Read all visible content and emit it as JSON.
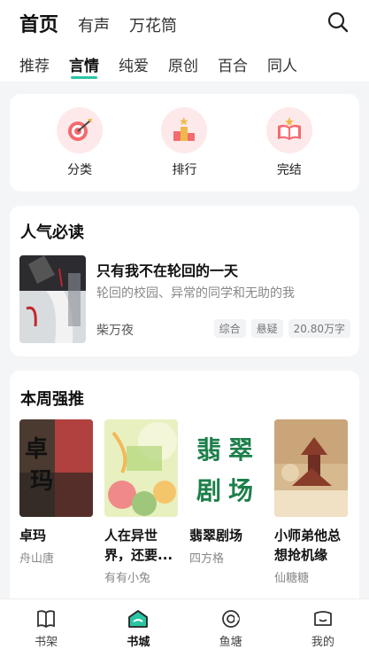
{
  "header": {
    "top_tabs": [
      "首页",
      "有声",
      "万花筒"
    ],
    "sub_tabs": [
      "推荐",
      "言情",
      "纯爱",
      "原创",
      "百合",
      "同人"
    ]
  },
  "categories": [
    {
      "label": "分类",
      "icon": "target-icon"
    },
    {
      "label": "排行",
      "icon": "trophy-icon"
    },
    {
      "label": "完结",
      "icon": "open-book-icon"
    }
  ],
  "popular": {
    "title": "人气必读",
    "book": {
      "title": "只有我不在轮回的一天",
      "desc": "轮回的校园、异常的同学和无助的我",
      "author": "柴万夜",
      "tags": [
        "综合",
        "悬疑",
        "20.80万字"
      ]
    }
  },
  "weekly": {
    "title": "本周强推",
    "books": [
      {
        "title": "卓玛",
        "author": "舟山唐",
        "cover_text": "卓玛"
      },
      {
        "title": "人在异世界，还要...",
        "author": "有有小兔",
        "cover_text": ""
      },
      {
        "title": "翡翠剧场",
        "author": "四方格",
        "cover_text": "翡翠剧场"
      },
      {
        "title": "小师弟他总想抢机缘",
        "author": "仙糖糖",
        "cover_text": ""
      }
    ]
  },
  "nav": [
    "书架",
    "书城",
    "鱼塘",
    "我的"
  ],
  "colors": {
    "accent": "#2bc4a4",
    "icon_bg": "#fde9ea"
  }
}
